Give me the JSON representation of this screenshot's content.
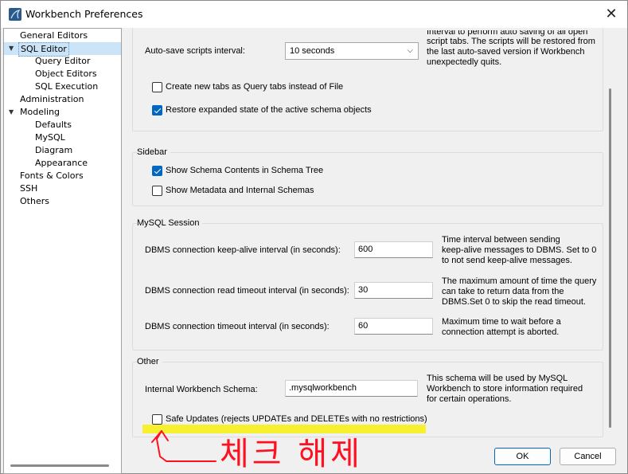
{
  "window": {
    "title": "Workbench Preferences",
    "close_glyph": "✕"
  },
  "sidebar": {
    "items": [
      {
        "label": "General Editors"
      },
      {
        "label": "SQL Editor",
        "selected": true,
        "expanded": true
      },
      {
        "label": "Query Editor"
      },
      {
        "label": "Object Editors"
      },
      {
        "label": "SQL Execution"
      },
      {
        "label": "Administration"
      },
      {
        "label": "Modeling",
        "expanded": true
      },
      {
        "label": "Defaults"
      },
      {
        "label": "MySQL"
      },
      {
        "label": "Diagram"
      },
      {
        "label": "Appearance"
      },
      {
        "label": "Fonts & Colors"
      },
      {
        "label": "SSH"
      },
      {
        "label": "Others"
      }
    ]
  },
  "sql_editor": {
    "autosave_label": "Auto-save scripts interval:",
    "autosave_value": "10 seconds",
    "autosave_desc_partial": "Interval to perform auto-saving of all open script tabs. The scripts will be restored from the last auto-saved version if Workbench unexpectedly quits.",
    "autosave_desc_line1": "Interval to perform auto saving of all open",
    "autosave_desc_line2": "script tabs. The scripts will be restored from",
    "autosave_desc_line3": "the last auto-saved version if Workbench",
    "autosave_desc_line4": "unexpectedly quits.",
    "create_tabs_label": "Create new tabs as Query tabs instead of File",
    "create_tabs_checked": false,
    "restore_state_label": "Restore expanded state of the active schema objects",
    "restore_state_checked": true
  },
  "sidebar_group": {
    "title": "Sidebar",
    "show_schema_label": "Show Schema Contents in Schema Tree",
    "show_schema_checked": true,
    "show_metadata_label": "Show Metadata and Internal Schemas",
    "show_metadata_checked": false
  },
  "session_group": {
    "title": "MySQL Session",
    "keepalive_label": "DBMS connection keep-alive interval (in seconds):",
    "keepalive_value": "600",
    "keepalive_desc1": "Time interval between sending",
    "keepalive_desc2": "keep-alive messages to DBMS. Set to 0",
    "keepalive_desc3": "to not send keep-alive messages.",
    "read_timeout_label": "DBMS connection read timeout interval (in seconds):",
    "read_timeout_value": "30",
    "read_timeout_desc1": "The maximum amount of time the query",
    "read_timeout_desc2": "can take to return data from the",
    "read_timeout_desc3": "DBMS.Set 0 to skip the read timeout.",
    "conn_timeout_label": "DBMS connection timeout interval (in seconds):",
    "conn_timeout_value": "60",
    "conn_timeout_desc1": "Maximum time to wait before a",
    "conn_timeout_desc2": "connection attempt is aborted."
  },
  "other_group": {
    "title": "Other",
    "schema_label": "Internal Workbench Schema:",
    "schema_value": ".mysqlworkbench",
    "schema_desc1": "This schema will be used by MySQL",
    "schema_desc2": "Workbench to store information required",
    "schema_desc3": "for certain operations.",
    "safe_updates_label": "Safe Updates (rejects UPDATEs and DELETEs with no restrictions)",
    "safe_updates_checked": false
  },
  "buttons": {
    "ok": "OK",
    "cancel": "Cancel"
  },
  "annotation": {
    "text": "체크 해제",
    "color": "#ff1020",
    "highlight_color": "#f7f018"
  }
}
